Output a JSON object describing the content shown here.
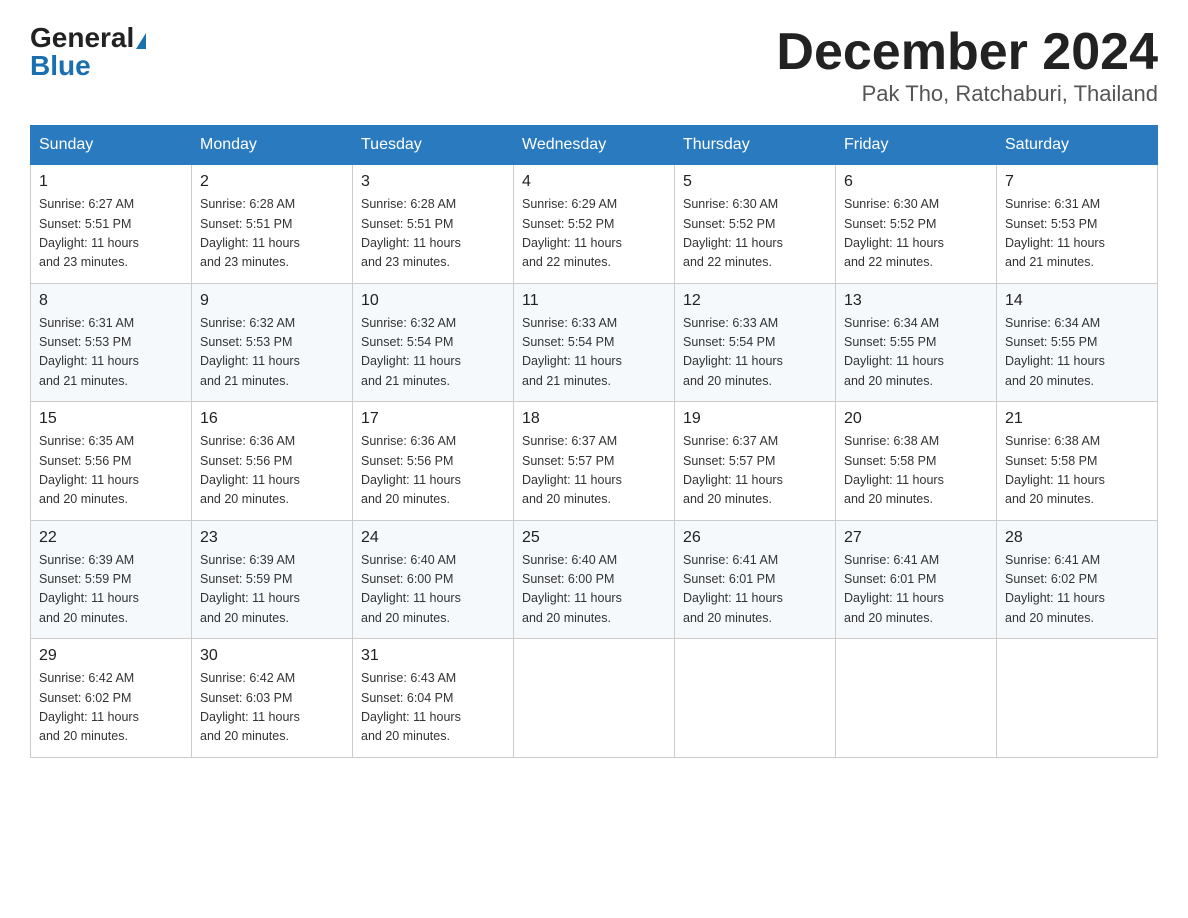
{
  "header": {
    "logo_general": "General",
    "logo_blue": "Blue",
    "month_year": "December 2024",
    "location": "Pak Tho, Ratchaburi, Thailand"
  },
  "days_of_week": [
    "Sunday",
    "Monday",
    "Tuesday",
    "Wednesday",
    "Thursday",
    "Friday",
    "Saturday"
  ],
  "weeks": [
    [
      {
        "num": "1",
        "sunrise": "6:27 AM",
        "sunset": "5:51 PM",
        "daylight": "11 hours and 23 minutes."
      },
      {
        "num": "2",
        "sunrise": "6:28 AM",
        "sunset": "5:51 PM",
        "daylight": "11 hours and 23 minutes."
      },
      {
        "num": "3",
        "sunrise": "6:28 AM",
        "sunset": "5:51 PM",
        "daylight": "11 hours and 23 minutes."
      },
      {
        "num": "4",
        "sunrise": "6:29 AM",
        "sunset": "5:52 PM",
        "daylight": "11 hours and 22 minutes."
      },
      {
        "num": "5",
        "sunrise": "6:30 AM",
        "sunset": "5:52 PM",
        "daylight": "11 hours and 22 minutes."
      },
      {
        "num": "6",
        "sunrise": "6:30 AM",
        "sunset": "5:52 PM",
        "daylight": "11 hours and 22 minutes."
      },
      {
        "num": "7",
        "sunrise": "6:31 AM",
        "sunset": "5:53 PM",
        "daylight": "11 hours and 21 minutes."
      }
    ],
    [
      {
        "num": "8",
        "sunrise": "6:31 AM",
        "sunset": "5:53 PM",
        "daylight": "11 hours and 21 minutes."
      },
      {
        "num": "9",
        "sunrise": "6:32 AM",
        "sunset": "5:53 PM",
        "daylight": "11 hours and 21 minutes."
      },
      {
        "num": "10",
        "sunrise": "6:32 AM",
        "sunset": "5:54 PM",
        "daylight": "11 hours and 21 minutes."
      },
      {
        "num": "11",
        "sunrise": "6:33 AM",
        "sunset": "5:54 PM",
        "daylight": "11 hours and 21 minutes."
      },
      {
        "num": "12",
        "sunrise": "6:33 AM",
        "sunset": "5:54 PM",
        "daylight": "11 hours and 20 minutes."
      },
      {
        "num": "13",
        "sunrise": "6:34 AM",
        "sunset": "5:55 PM",
        "daylight": "11 hours and 20 minutes."
      },
      {
        "num": "14",
        "sunrise": "6:34 AM",
        "sunset": "5:55 PM",
        "daylight": "11 hours and 20 minutes."
      }
    ],
    [
      {
        "num": "15",
        "sunrise": "6:35 AM",
        "sunset": "5:56 PM",
        "daylight": "11 hours and 20 minutes."
      },
      {
        "num": "16",
        "sunrise": "6:36 AM",
        "sunset": "5:56 PM",
        "daylight": "11 hours and 20 minutes."
      },
      {
        "num": "17",
        "sunrise": "6:36 AM",
        "sunset": "5:56 PM",
        "daylight": "11 hours and 20 minutes."
      },
      {
        "num": "18",
        "sunrise": "6:37 AM",
        "sunset": "5:57 PM",
        "daylight": "11 hours and 20 minutes."
      },
      {
        "num": "19",
        "sunrise": "6:37 AM",
        "sunset": "5:57 PM",
        "daylight": "11 hours and 20 minutes."
      },
      {
        "num": "20",
        "sunrise": "6:38 AM",
        "sunset": "5:58 PM",
        "daylight": "11 hours and 20 minutes."
      },
      {
        "num": "21",
        "sunrise": "6:38 AM",
        "sunset": "5:58 PM",
        "daylight": "11 hours and 20 minutes."
      }
    ],
    [
      {
        "num": "22",
        "sunrise": "6:39 AM",
        "sunset": "5:59 PM",
        "daylight": "11 hours and 20 minutes."
      },
      {
        "num": "23",
        "sunrise": "6:39 AM",
        "sunset": "5:59 PM",
        "daylight": "11 hours and 20 minutes."
      },
      {
        "num": "24",
        "sunrise": "6:40 AM",
        "sunset": "6:00 PM",
        "daylight": "11 hours and 20 minutes."
      },
      {
        "num": "25",
        "sunrise": "6:40 AM",
        "sunset": "6:00 PM",
        "daylight": "11 hours and 20 minutes."
      },
      {
        "num": "26",
        "sunrise": "6:41 AM",
        "sunset": "6:01 PM",
        "daylight": "11 hours and 20 minutes."
      },
      {
        "num": "27",
        "sunrise": "6:41 AM",
        "sunset": "6:01 PM",
        "daylight": "11 hours and 20 minutes."
      },
      {
        "num": "28",
        "sunrise": "6:41 AM",
        "sunset": "6:02 PM",
        "daylight": "11 hours and 20 minutes."
      }
    ],
    [
      {
        "num": "29",
        "sunrise": "6:42 AM",
        "sunset": "6:02 PM",
        "daylight": "11 hours and 20 minutes."
      },
      {
        "num": "30",
        "sunrise": "6:42 AM",
        "sunset": "6:03 PM",
        "daylight": "11 hours and 20 minutes."
      },
      {
        "num": "31",
        "sunrise": "6:43 AM",
        "sunset": "6:04 PM",
        "daylight": "11 hours and 20 minutes."
      },
      null,
      null,
      null,
      null
    ]
  ],
  "labels": {
    "sunrise": "Sunrise:",
    "sunset": "Sunset:",
    "daylight": "Daylight:"
  }
}
